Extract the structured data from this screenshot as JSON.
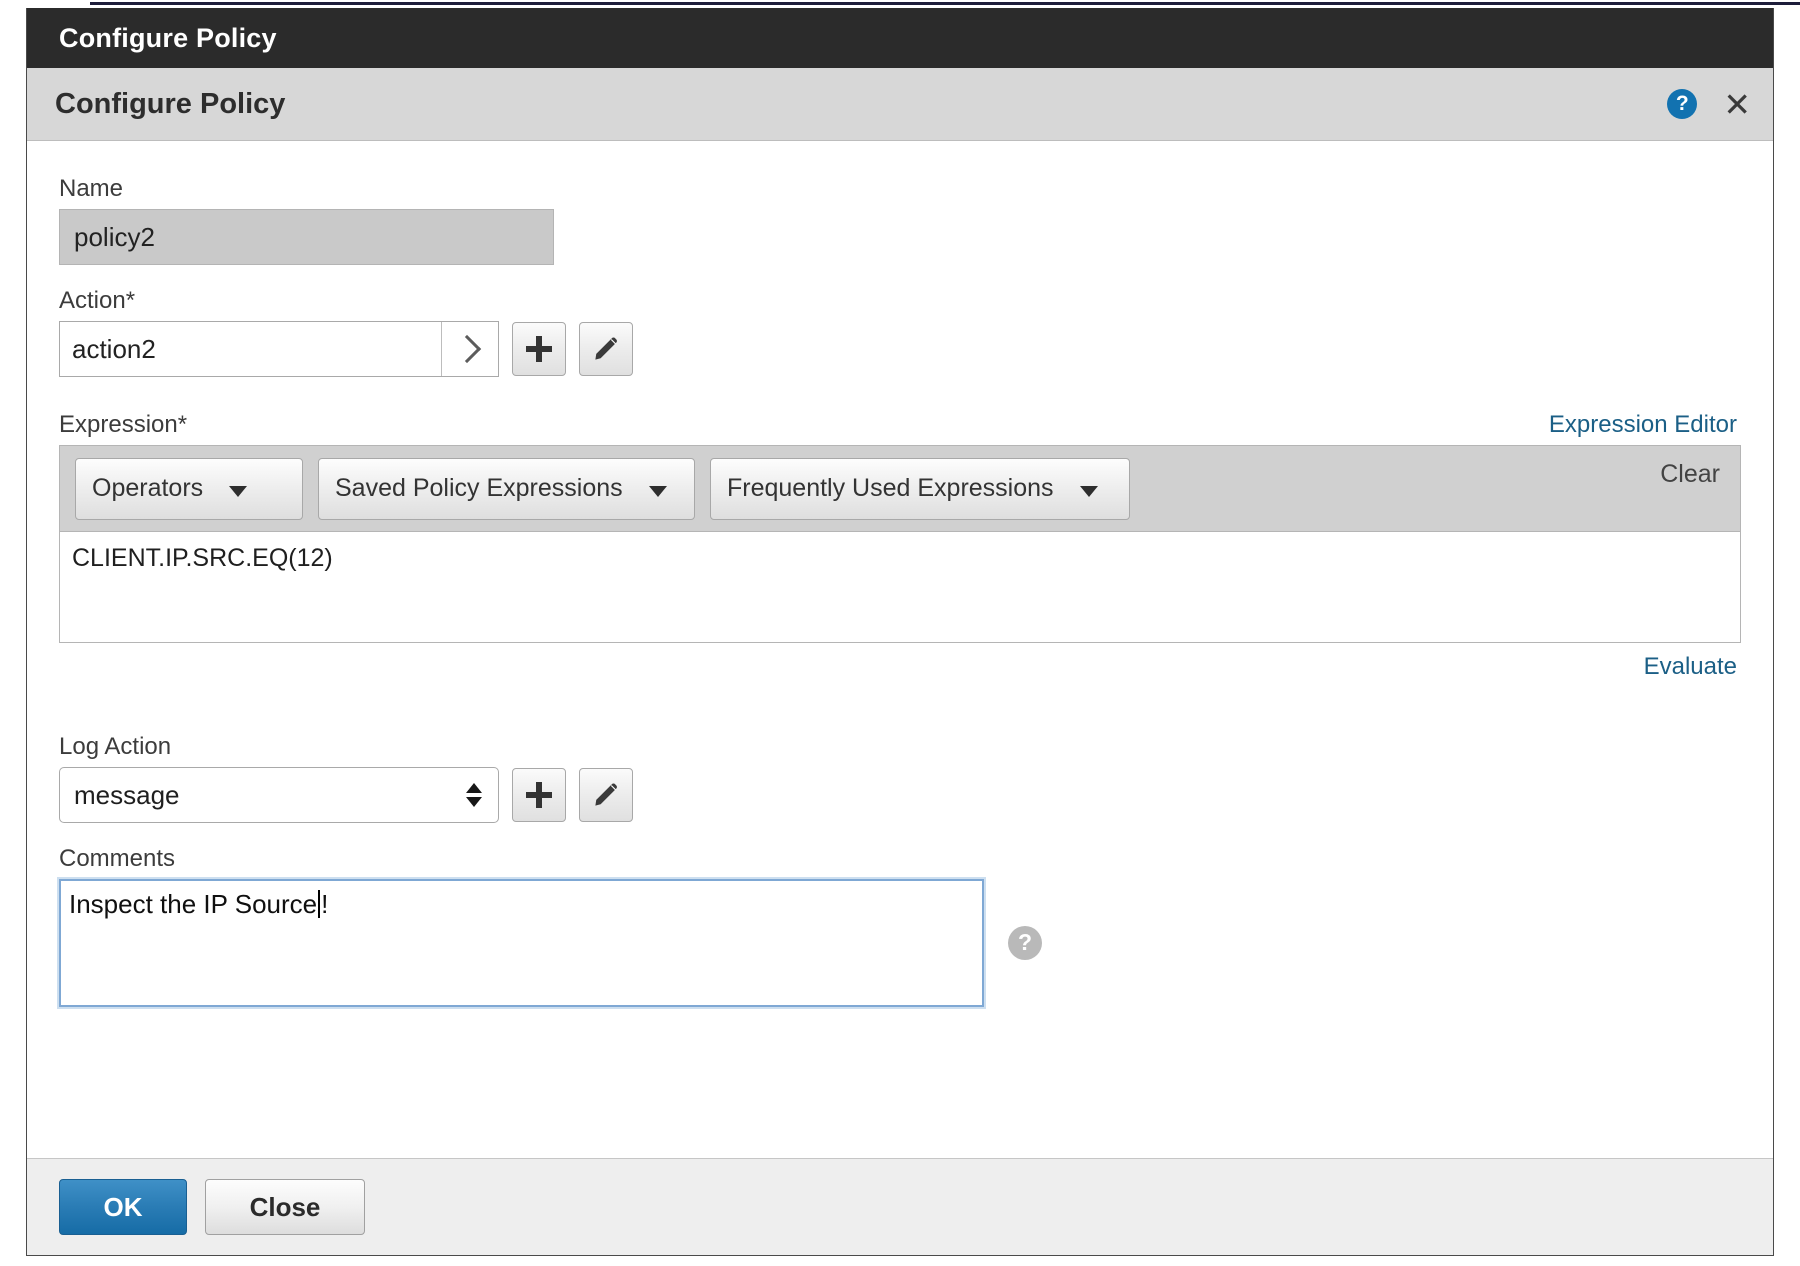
{
  "window": {
    "titlebar_title": "Configure Policy",
    "dialog_title": "Configure Policy",
    "help_icon": "help-icon",
    "help_glyph": "?",
    "close_icon": "close-icon",
    "close_glyph": "✕"
  },
  "form": {
    "name": {
      "label": "Name",
      "value": "policy2",
      "readonly": true
    },
    "action": {
      "label": "Action*",
      "value": "action2",
      "browse_icon": "chevron-right-icon",
      "add_icon": "plus-icon",
      "edit_icon": "pencil-icon"
    },
    "expression": {
      "label": "Expression*",
      "editor_link": "Expression Editor",
      "clear_link": "Clear",
      "evaluate_link": "Evaluate",
      "value": "CLIENT.IP.SRC.EQ(12)",
      "dropdowns": [
        {
          "label": "Operators",
          "caret_icon": "chevron-down-icon"
        },
        {
          "label": "Saved Policy Expressions",
          "caret_icon": "chevron-down-icon"
        },
        {
          "label": "Frequently Used Expressions",
          "caret_icon": "chevron-down-icon"
        }
      ]
    },
    "log_action": {
      "label": "Log Action",
      "value": "message",
      "spinner_icon": "spinner-updown-icon",
      "add_icon": "plus-icon",
      "edit_icon": "pencil-icon"
    },
    "comments": {
      "label": "Comments",
      "value": "Inspect the IP Source",
      "value_tail": "!",
      "help_icon": "help-icon",
      "help_glyph": "?",
      "focused": true
    }
  },
  "footer": {
    "ok_label": "OK",
    "close_label": "Close"
  },
  "colors": {
    "titlebar_bg": "#2b2b2b",
    "subheader_bg": "#d7d7d7",
    "accent_blue": "#1272b0",
    "link_blue": "#1b5f86",
    "ok_button": "#2a7cb5",
    "focus_ring": "#7fa8d4",
    "readonly_field": "#c9c9c9",
    "toolbar_bg": "#d0d0d0",
    "footer_bg": "#eeeeee"
  }
}
